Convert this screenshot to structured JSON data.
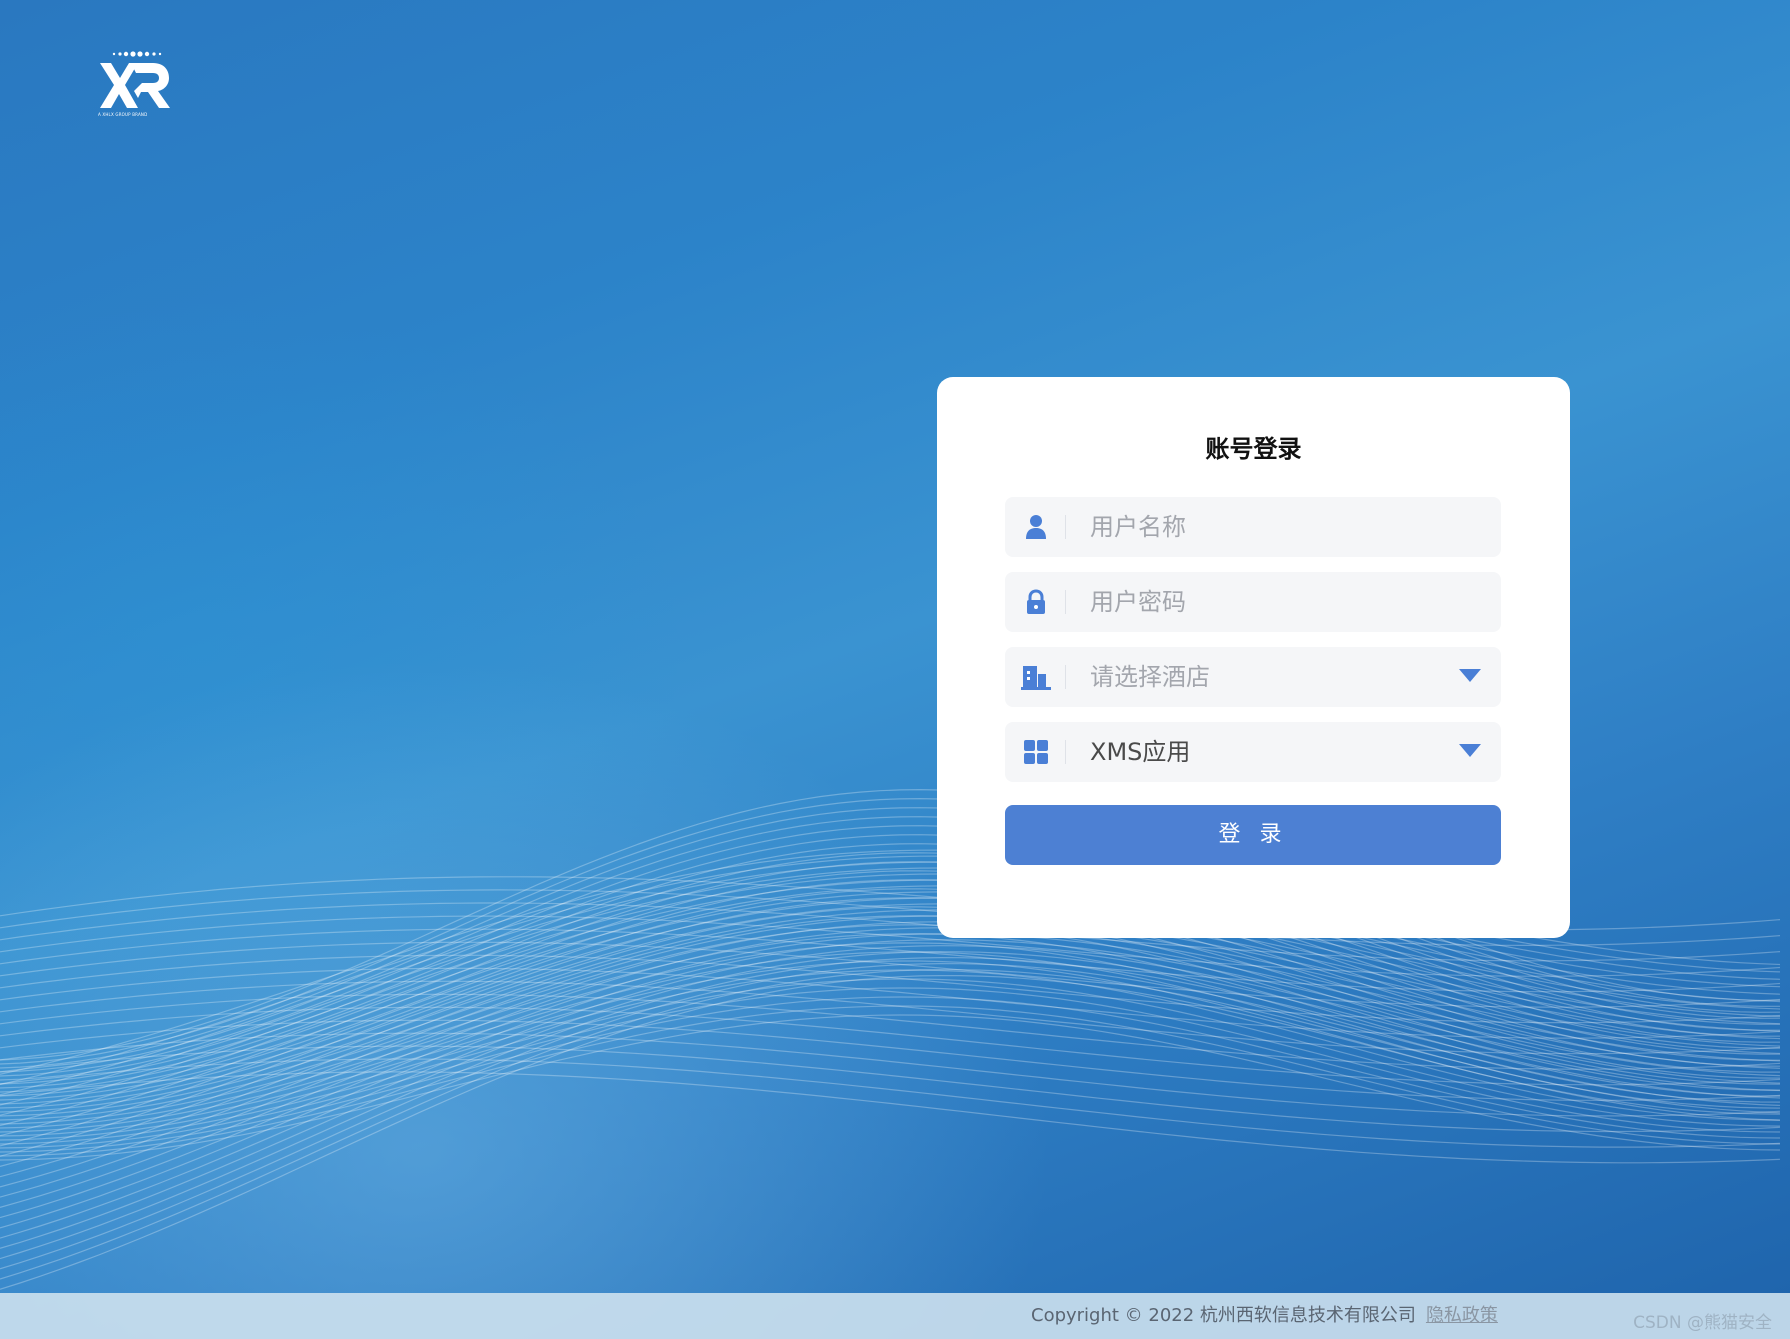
{
  "brand": {
    "logo_text": "XR",
    "logo_subtext": "A XHLX GROUP BRAND"
  },
  "login": {
    "title": "账号登录",
    "username_placeholder": "用户名称",
    "password_placeholder": "用户密码",
    "hotel_placeholder": "请选择酒店",
    "app_value": "XMS应用",
    "submit_label": "登 录"
  },
  "footer": {
    "copyright": "Copyright © 2022 杭州西软信息技术有限公司",
    "privacy_link": "隐私政策"
  },
  "watermark": "CSDN @熊猫安全",
  "icons": {
    "username": "user-icon",
    "password": "lock-icon",
    "hotel": "building-icon",
    "app": "grid-icon",
    "dropdown": "caret-down-icon"
  },
  "colors": {
    "accent": "#4d80d3",
    "icon": "#4a7fd6",
    "background_top": "#2a78c0",
    "background_bottom": "#1e63ab"
  }
}
